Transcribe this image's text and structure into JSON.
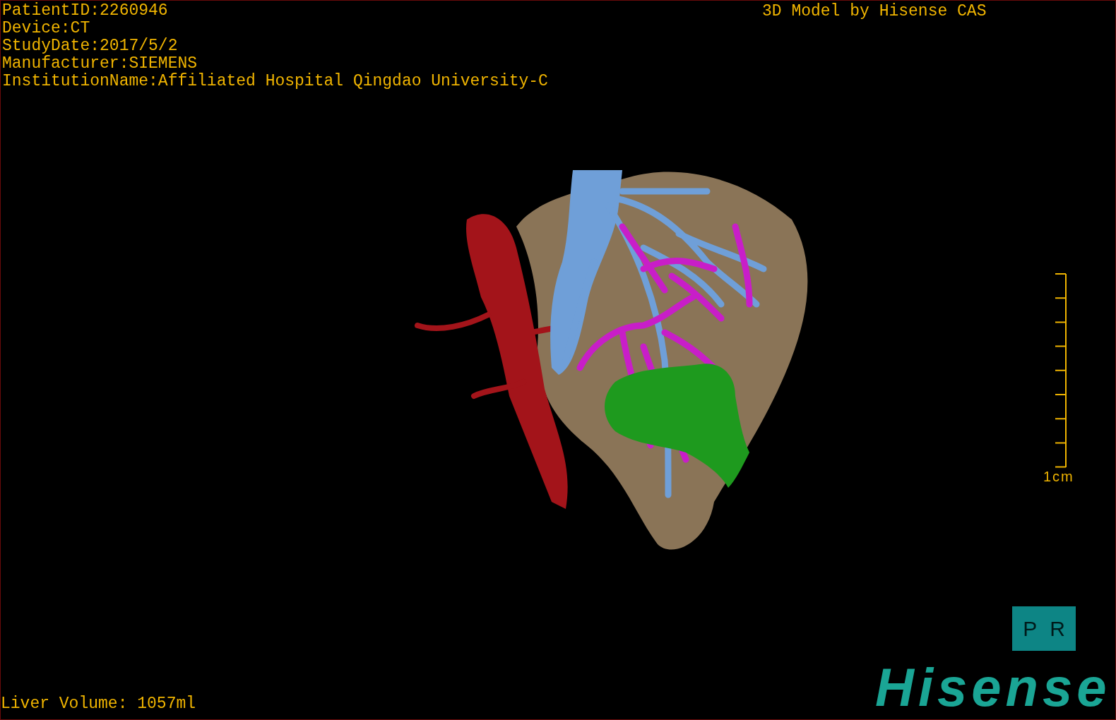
{
  "patient_info": [
    "PatientID:2260946",
    "Device:CT",
    "StudyDate:2017/5/2",
    "Manufacturer:SIEMENS",
    "InstitutionName:Affiliated Hospital Qingdao University-C"
  ],
  "model_credit": "3D Model by Hisense CAS",
  "scale_bar": {
    "label": "1cm"
  },
  "orientation_cube": {
    "labels": [
      "P",
      "R"
    ]
  },
  "liver_volume": "Liver Volume: 1057ml",
  "logo": "Hisense"
}
